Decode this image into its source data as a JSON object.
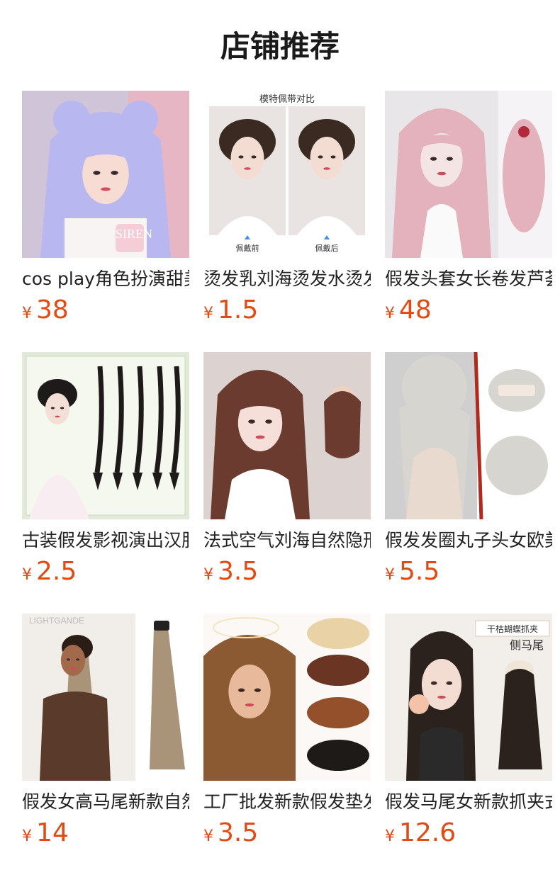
{
  "page": {
    "title": "店铺推荐"
  },
  "products": [
    {
      "name": "cos play角色扮演甜美",
      "currency": "¥",
      "price": "38",
      "image": {
        "icon": "lavender-wig-photo",
        "bg": "#cfc4d8",
        "hair": "#b9b7ef",
        "skin": "#f6dcd2",
        "accent": "#f2c3cf",
        "overlay_text": "SIREN"
      }
    },
    {
      "name": "烫发乳刘海烫发水烫发",
      "currency": "¥",
      "price": "1.5",
      "image": {
        "icon": "before-after-comparison",
        "bg": "#ffffff",
        "hair": "#3a2a22",
        "skin": "#f3ddd3",
        "accent": "#4a8fd6",
        "header_text": "模特佩带对比",
        "left_caption": "佩戴前",
        "right_caption": "佩戴后"
      }
    },
    {
      "name": "假发头套女长卷发芦荟",
      "currency": "¥",
      "price": "48",
      "image": {
        "icon": "pink-long-curly-wig",
        "bg": "#e9e6e9",
        "hair": "#e4b2bd",
        "skin": "#f4e4e4",
        "accent": "#ffffff"
      }
    },
    {
      "name": "古装假发影视演出汉服",
      "currency": "¥",
      "price": "2.5",
      "image": {
        "icon": "braid-extensions",
        "bg": "#e3e9d9",
        "hair": "#1f1a1a",
        "skin": "#f3dfd6",
        "accent": "#f8eef2"
      }
    },
    {
      "name": "法式空气刘海自然隐形",
      "currency": "¥",
      "price": "3.5",
      "image": {
        "icon": "air-bangs-clip",
        "bg": "#dcd3d1",
        "hair": "#6a3b2e",
        "skin": "#f5dfd8",
        "accent": "#ffffff"
      }
    },
    {
      "name": "假发发圈丸子头女欧美",
      "currency": "¥",
      "price": "5.5",
      "image": {
        "icon": "messy-bun-scrunchie",
        "bg": "#cfcfcf",
        "hair": "#d7d5d0",
        "skin": "#e9dad0",
        "accent": "#b02a1e"
      }
    },
    {
      "name": "假发女高马尾新款自然",
      "currency": "¥",
      "price": "14",
      "image": {
        "icon": "high-ponytail-extension",
        "bg": "#ffffff",
        "hair": "#a99479",
        "skin": "#a26a4b",
        "accent": "#5a3a2a",
        "overlay_text": "LIGHTGANDE"
      }
    },
    {
      "name": "工厂批发新款假发垫发",
      "currency": "¥",
      "price": "3.5",
      "image": {
        "icon": "volume-hair-pads",
        "bg": "#fbf8f5",
        "hair": "#8b5a32",
        "skin": "#e8b99a",
        "accent": "#e9d3a6"
      }
    },
    {
      "name": "假发马尾女新款抓夹式",
      "currency": "¥",
      "price": "12.6",
      "image": {
        "icon": "claw-clip-ponytail",
        "bg": "#f2efeb",
        "hair": "#2b211d",
        "skin": "#f3dcd2",
        "accent": "#f3c2a8",
        "badge_text": "干枯蝴蝶抓夹",
        "badge_text2": "侧马尾"
      }
    }
  ]
}
